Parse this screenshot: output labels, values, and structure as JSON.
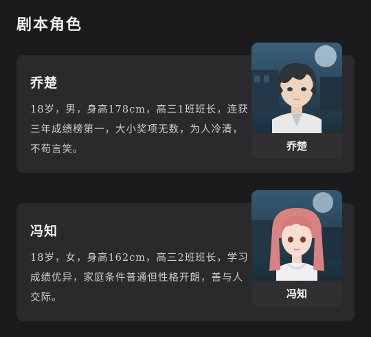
{
  "section_title": "剧本角色",
  "characters": [
    {
      "name": "乔楚",
      "description": "18岁，男，身高178cm，高三1班班长，连获三年成绩榜第一，大小奖项无数，为人冷清，不苟言笑。",
      "portrait_label": "乔楚",
      "portrait_icon": "male-student-portrait"
    },
    {
      "name": "冯知",
      "description": "18岁，女，身高162cm，高三2班班长，学习成绩优异，家庭条件普通但性格开朗，善与人交际。",
      "portrait_label": "冯知",
      "portrait_icon": "female-student-portrait"
    }
  ],
  "colors": {
    "background": "#1b1b1d",
    "card": "#2a2a2c",
    "portrait_footer": "#303033"
  }
}
